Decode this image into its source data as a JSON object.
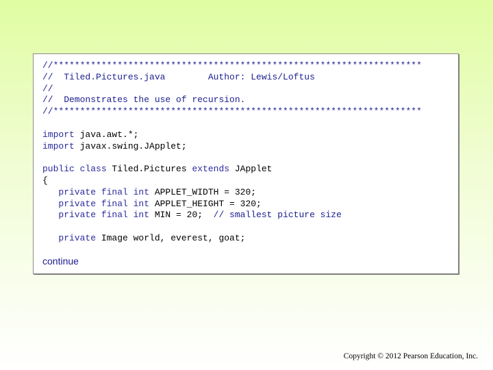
{
  "code": {
    "header": [
      "//*********************************************************************",
      "//  Tiled.Pictures.java        Author: Lewis/Loftus",
      "//",
      "//  Demonstrates the use of recursion.",
      "//*********************************************************************"
    ],
    "imports": [
      {
        "kw": "import",
        "rest": " java.awt.*;"
      },
      {
        "kw": "import",
        "rest": " javax.swing.JApplet;"
      }
    ],
    "class_decl": {
      "kw1": "public class",
      "name": " Tiled.Pictures ",
      "kw2": "extends",
      "rest": " JApplet"
    },
    "open_brace": "{",
    "fields": [
      {
        "kw": "   private final int",
        "rest": " APPLET_WIDTH = 320;",
        "comment": ""
      },
      {
        "kw": "   private final int",
        "rest": " APPLET_HEIGHT = 320;",
        "comment": ""
      },
      {
        "kw": "   private final int",
        "rest": " MIN = 20;  ",
        "comment": "// smallest picture size"
      }
    ],
    "image_field": {
      "kw": "   private",
      "rest": " Image world, everest, goat;"
    }
  },
  "continue_label": "continue",
  "copyright": "Copyright © 2012 Pearson Education, Inc.",
  "colors": {
    "background_top": "#e0fda2",
    "comment": "#1b1e8f",
    "keyword": "#2a2a9e",
    "continue": "#1a1a8c"
  }
}
